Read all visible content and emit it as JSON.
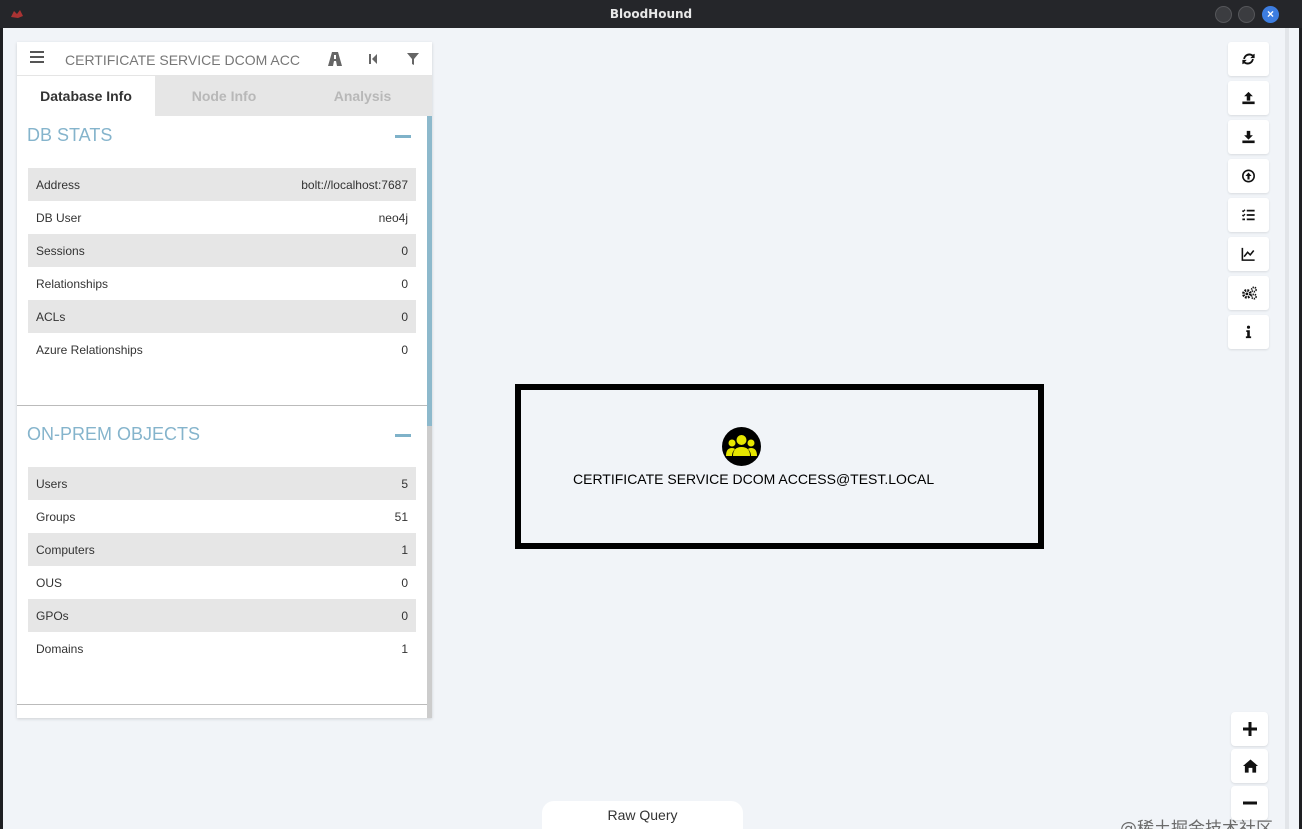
{
  "window": {
    "title": "BloodHound"
  },
  "search": {
    "value": "CERTIFICATE SERVICE DCOM ACC"
  },
  "tabs": [
    {
      "label": "Database Info"
    },
    {
      "label": "Node Info"
    },
    {
      "label": "Analysis"
    }
  ],
  "db_stats": {
    "title": "DB STATS",
    "rows": [
      {
        "label": "Address",
        "value": "bolt://localhost:7687"
      },
      {
        "label": "DB User",
        "value": "neo4j"
      },
      {
        "label": "Sessions",
        "value": "0"
      },
      {
        "label": "Relationships",
        "value": "0"
      },
      {
        "label": "ACLs",
        "value": "0"
      },
      {
        "label": "Azure Relationships",
        "value": "0"
      }
    ]
  },
  "onprem": {
    "title": "ON-PREM OBJECTS",
    "rows": [
      {
        "label": "Users",
        "value": "5"
      },
      {
        "label": "Groups",
        "value": "51"
      },
      {
        "label": "Computers",
        "value": "1"
      },
      {
        "label": "OUS",
        "value": "0"
      },
      {
        "label": "GPOs",
        "value": "0"
      },
      {
        "label": "Domains",
        "value": "1"
      }
    ]
  },
  "graph": {
    "node_label": "CERTIFICATE SERVICE DCOM ACCESS@TEST.LOCAL",
    "node_icon": "group-icon",
    "node_icon_color": "#e6e600"
  },
  "toolbar": [
    "refresh-icon",
    "upload-icon",
    "download-icon",
    "import-icon",
    "queries-icon",
    "stats-icon",
    "settings-icon",
    "info-icon"
  ],
  "raw_query": {
    "label": "Raw Query"
  },
  "watermark": "@稀土掘金技术社区",
  "colors": {
    "accent": "#85b4cc",
    "panel_bg": "#ffffff",
    "canvas_bg": "#f1f4f8",
    "close_button": "#3d7de0"
  }
}
